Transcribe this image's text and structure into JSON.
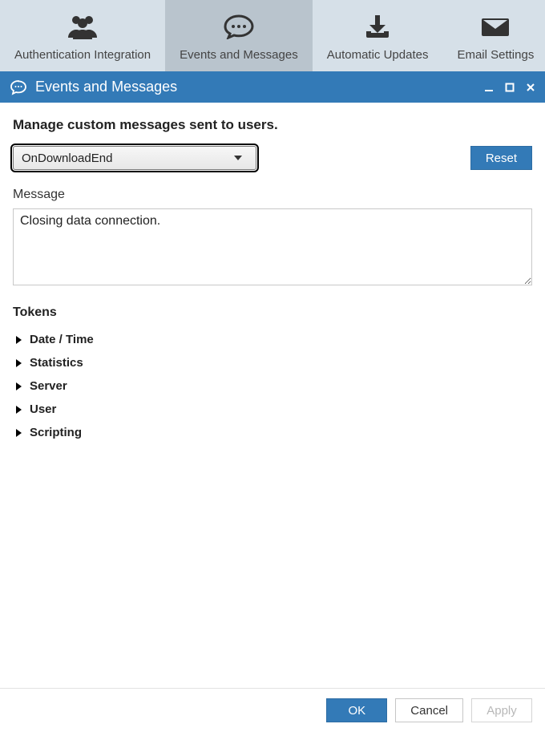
{
  "tabs": [
    {
      "label": "Authentication Integration"
    },
    {
      "label": "Events and Messages"
    },
    {
      "label": "Automatic Updates"
    },
    {
      "label": "Email Settings"
    }
  ],
  "titlebar": {
    "title": "Events and Messages"
  },
  "page": {
    "subhead": "Manage custom messages sent to users.",
    "event_select": {
      "value": "OnDownloadEnd"
    },
    "reset_label": "Reset",
    "message_label": "Message",
    "message_value": "Closing data connection.",
    "tokens_head": "Tokens",
    "tokens": [
      {
        "label": "Date / Time"
      },
      {
        "label": "Statistics"
      },
      {
        "label": "Server"
      },
      {
        "label": "User"
      },
      {
        "label": "Scripting"
      }
    ]
  },
  "actions": {
    "ok": "OK",
    "cancel": "Cancel",
    "apply": "Apply"
  }
}
